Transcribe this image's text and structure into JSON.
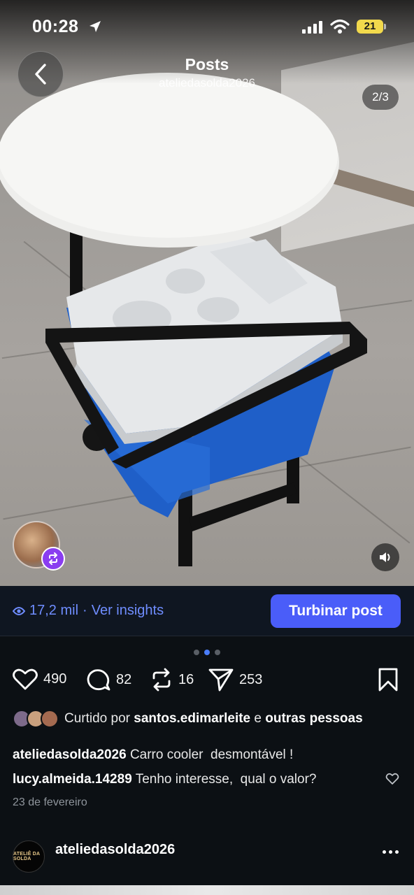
{
  "status_bar": {
    "time": "00:28",
    "battery": "21"
  },
  "header": {
    "title": "Posts",
    "subtitle": "ateliedasolda2026",
    "counter": "2/3"
  },
  "insights": {
    "views": "17,2 mil",
    "separator": "·",
    "insights_label": "Ver insights",
    "boost_label": "Turbinar post"
  },
  "actions": {
    "likes": "490",
    "comments": "82",
    "reposts": "16",
    "shares": "253"
  },
  "liked_by": {
    "prefix": "Curtido por",
    "user": "santos.edimarleite",
    "conj": "e",
    "others": "outras pessoas"
  },
  "caption": {
    "user": "ateliedasolda2026",
    "text": "Carro cooler  desmontável !"
  },
  "comment": {
    "user": "lucy.almeida.14289",
    "text": "Tenho interesse,  qual o valor?"
  },
  "date": "23 de fevereiro",
  "author": {
    "name": "ateliedasolda2026",
    "avatar_text": "ATELIÊ DA SOLDA"
  },
  "colors": {
    "accent": "#4a5df9",
    "link": "#6f8dff",
    "background": "#0c1014",
    "battery": "#f2d94c",
    "repost_badge": "#8a3df0"
  },
  "icons": [
    "location-arrow-icon",
    "signal-icon",
    "wifi-icon",
    "back-chevron-icon",
    "eye-icon",
    "heart-icon",
    "comment-icon",
    "repost-icon",
    "share-icon",
    "bookmark-icon",
    "sound-icon",
    "more-icon"
  ]
}
